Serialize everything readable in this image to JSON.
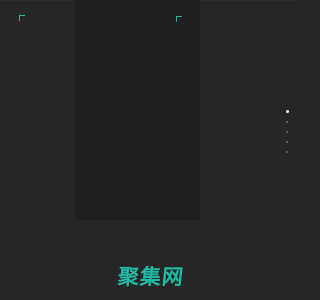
{
  "brand": {
    "logo_text": "聚集网",
    "color": "#22b8a4"
  },
  "pagination": {
    "total": 5,
    "active_index": 0
  },
  "colors": {
    "background": "#262626",
    "panel": "#202020",
    "accent": "#22b8a4"
  }
}
